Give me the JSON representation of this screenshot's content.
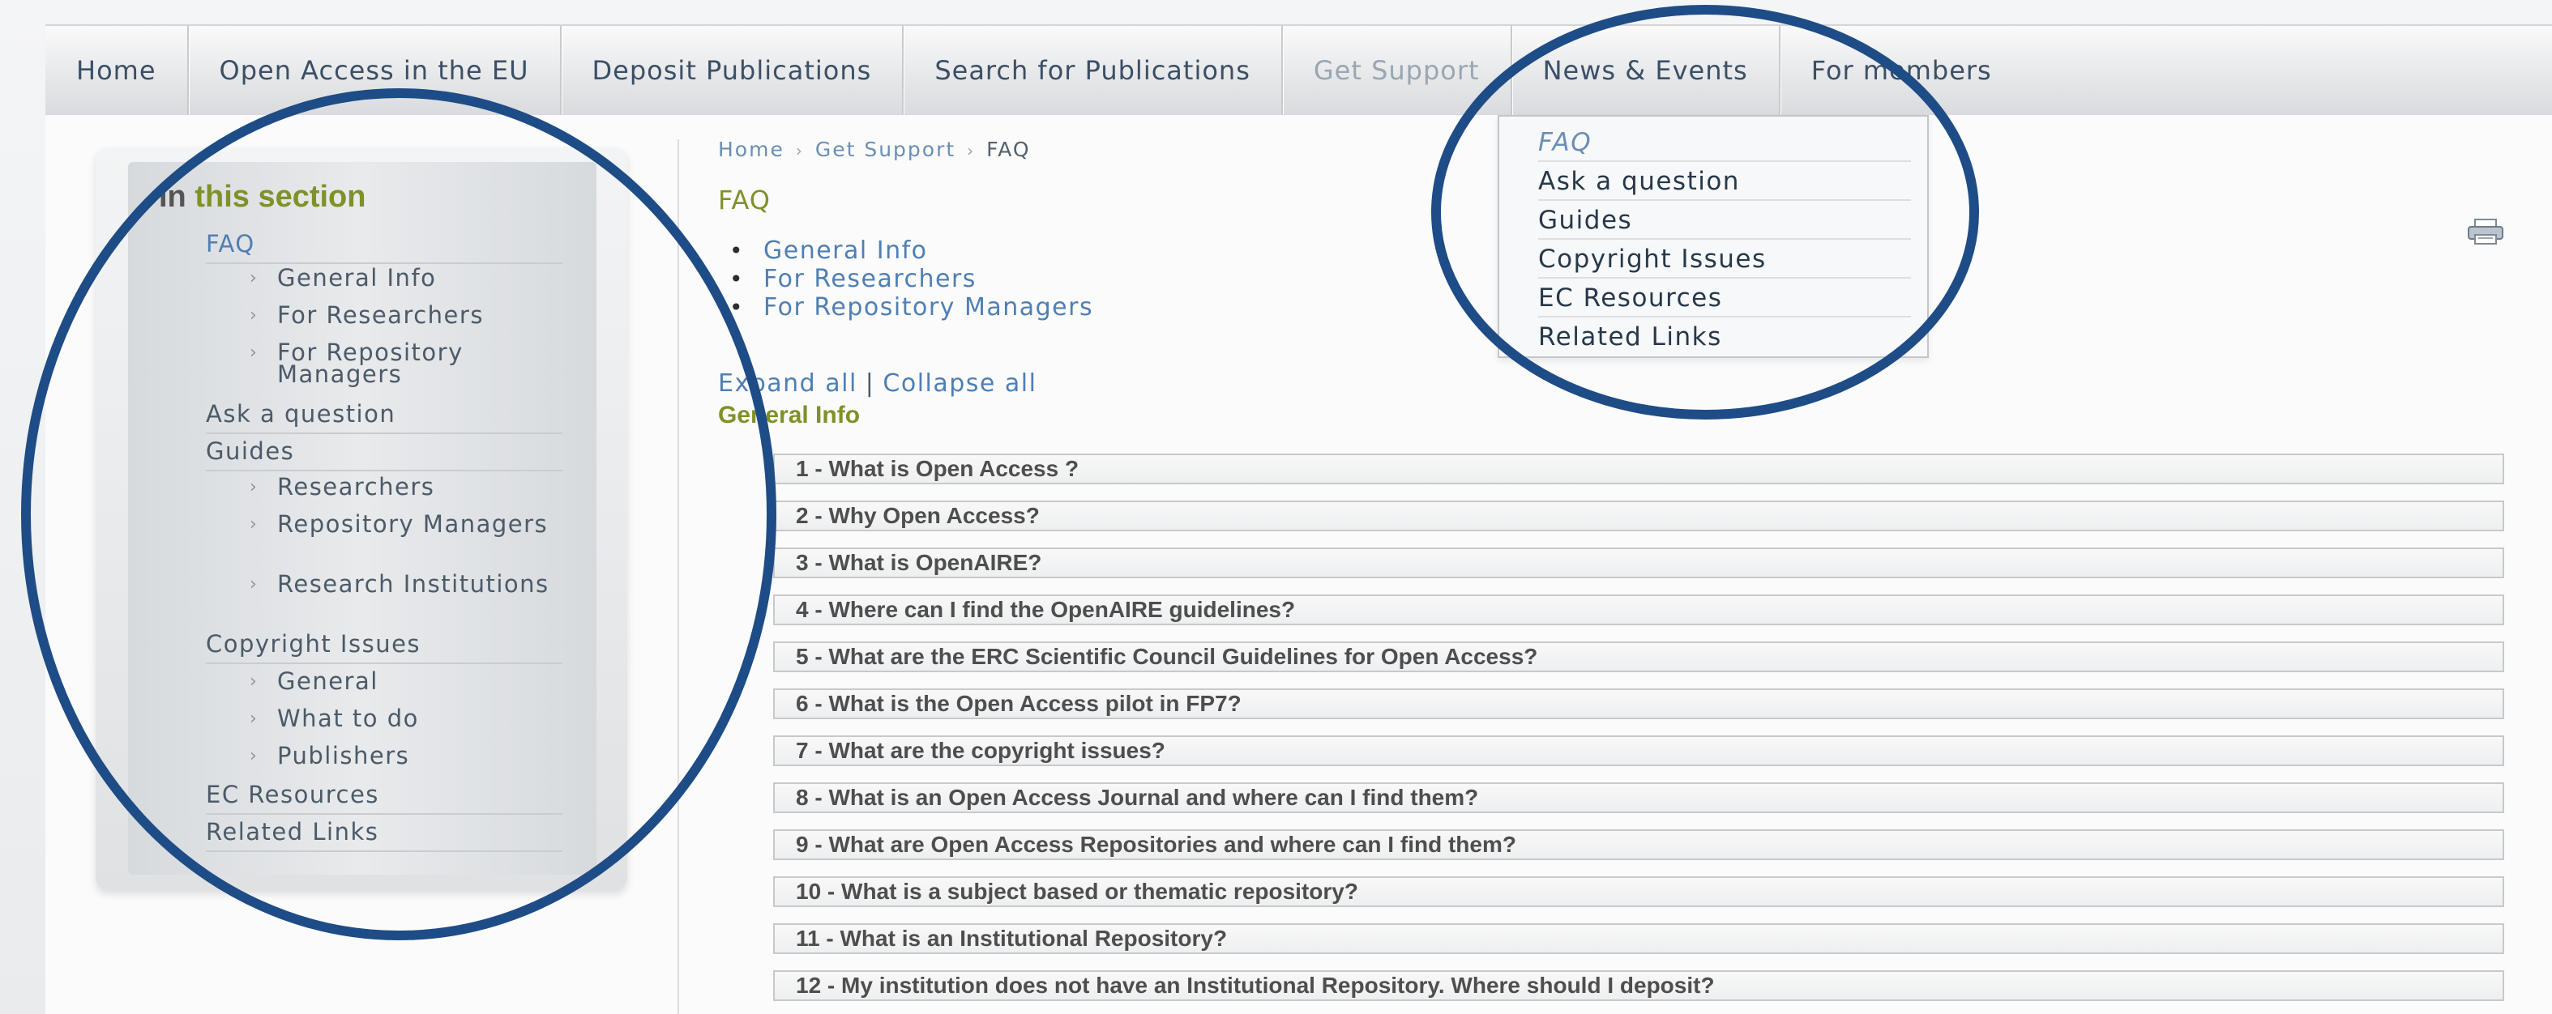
{
  "nav": {
    "items": [
      {
        "label": "Home"
      },
      {
        "label": "Open Access in the EU"
      },
      {
        "label": "Deposit Publications"
      },
      {
        "label": "Search for Publications"
      },
      {
        "label": "Get Support"
      },
      {
        "label": "News & Events"
      },
      {
        "label": "For members"
      }
    ],
    "active_index": 4
  },
  "dropdown": {
    "items": [
      {
        "label": "FAQ"
      },
      {
        "label": "Ask a question"
      },
      {
        "label": "Guides"
      },
      {
        "label": "Copyright Issues"
      },
      {
        "label": "EC Resources"
      },
      {
        "label": "Related Links"
      }
    ],
    "current_index": 0
  },
  "sidebar": {
    "title_prefix": "In ",
    "title_highlight": "this section",
    "items": [
      {
        "label": "FAQ",
        "children": [
          "General Info",
          "For Researchers",
          "For Repository Managers"
        ]
      },
      {
        "label": "Ask a question",
        "children": []
      },
      {
        "label": "Guides",
        "children": [
          "Researchers",
          "Repository Managers",
          "Research Institutions"
        ]
      },
      {
        "label": "Copyright Issues",
        "children": [
          "General",
          "What to do",
          "Publishers"
        ]
      },
      {
        "label": "EC Resources",
        "children": []
      },
      {
        "label": "Related Links",
        "children": []
      }
    ]
  },
  "breadcrumb": {
    "items": [
      "Home",
      "Get Support",
      "FAQ"
    ],
    "separator": "›"
  },
  "main": {
    "title": "FAQ",
    "section_links": [
      "General Info",
      "For Researchers",
      "For Repository Managers"
    ],
    "expand_all": "Expand all",
    "collapse_all": "Collapse all",
    "section_heading": "General Info",
    "questions": [
      "1 - What is Open Access ?",
      "2 - Why Open Access?",
      "3 - What is OpenAIRE?",
      "4 - Where can I find the OpenAIRE guidelines?",
      "5 - What are the ERC Scientific Council Guidelines for Open Access?",
      "6 - What is the Open Access pilot in FP7?",
      "7 - What are the copyright issues?",
      "8 - What is an Open Access Journal and where can I find them?",
      "9 - What are Open Access Repositories and where can I find them?",
      "10 - What is a subject based or thematic repository?",
      "11 - What is an Institutional Repository?",
      "12 - My institution does not have an Institutional Repository. Where should I deposit?"
    ]
  },
  "icons": {
    "print": "print-icon",
    "chevron": "chevron-right-icon"
  },
  "colors": {
    "link": "#4f7fb3",
    "accent_green": "#7e9228",
    "annotation": "#1e4c86"
  }
}
